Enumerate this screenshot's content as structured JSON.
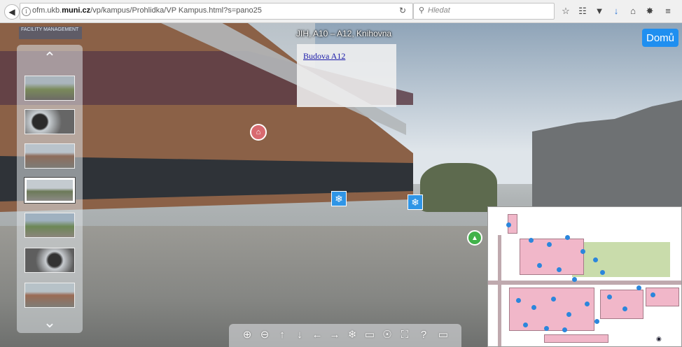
{
  "browser": {
    "url_prefix": "ofm.ukb.",
    "url_domain": "muni.cz",
    "url_path": "/vp/kampus/Prohlidka/VP Kampus.html?s=pano25",
    "search_placeholder": "Hledat"
  },
  "pano": {
    "title": "JIH, A10 – A12, Knihovna",
    "link": "Budova A12",
    "logo_line1": "FACILITY MANAGEMENT",
    "home_label": "Domů"
  },
  "thumbs": {
    "count": 7,
    "selected_index": 3
  },
  "toolbar": {
    "icons": [
      "zoom-in-icon",
      "zoom-out-icon",
      "arrow-up-icon",
      "arrow-down-icon",
      "arrow-left-icon",
      "arrow-right-icon",
      "hotspots-icon",
      "rectangle-icon",
      "globe-icon",
      "fullscreen-icon",
      "help-icon",
      "screen-icon"
    ]
  }
}
